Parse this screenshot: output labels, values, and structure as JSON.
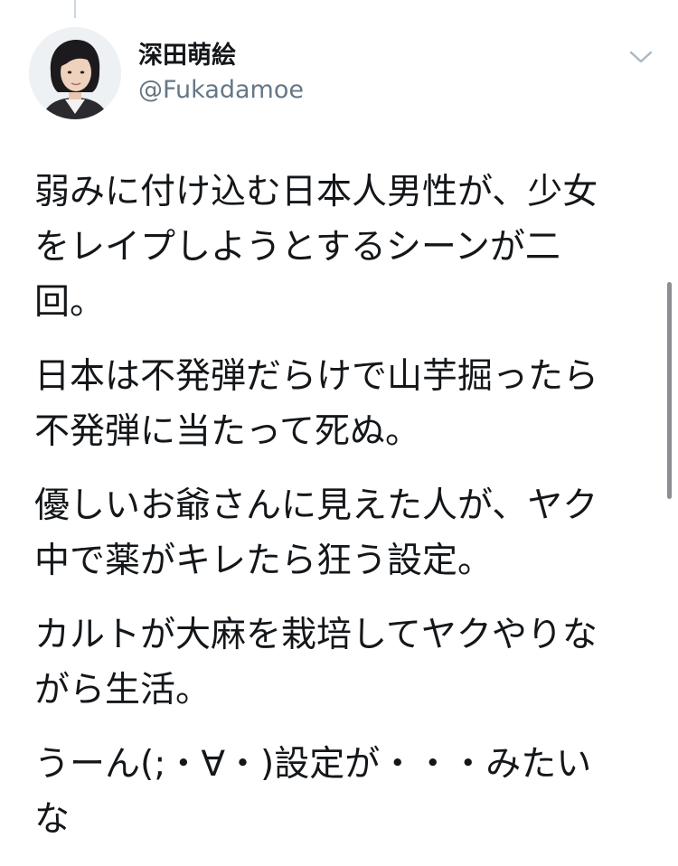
{
  "tweet": {
    "author": {
      "display_name": "深田萌絵",
      "handle": "@Fukadamoe",
      "avatar": "profile-photo"
    },
    "menu_icon": "chevron-down-icon",
    "paragraphs": [
      "弱みに付け込む日本人男性が、少女\nをレイプしようとするシーンが二\n回。",
      "日本は不発弾だらけで山芋掘ったら\n不発弾に当たって死ぬ。",
      "優しいお爺さんに見えた人が、ヤク\n中で薬がキレたら狂う設定。",
      "カルトが大麻を栽培してヤクやりな\nがら生活。",
      "うーん(;・∀・)設定が・・・みたい\nな"
    ]
  },
  "colors": {
    "text": "#14171a",
    "secondary_text": "#657786",
    "icon": "#aab8c2",
    "scrollbar": "#8e8e93"
  }
}
